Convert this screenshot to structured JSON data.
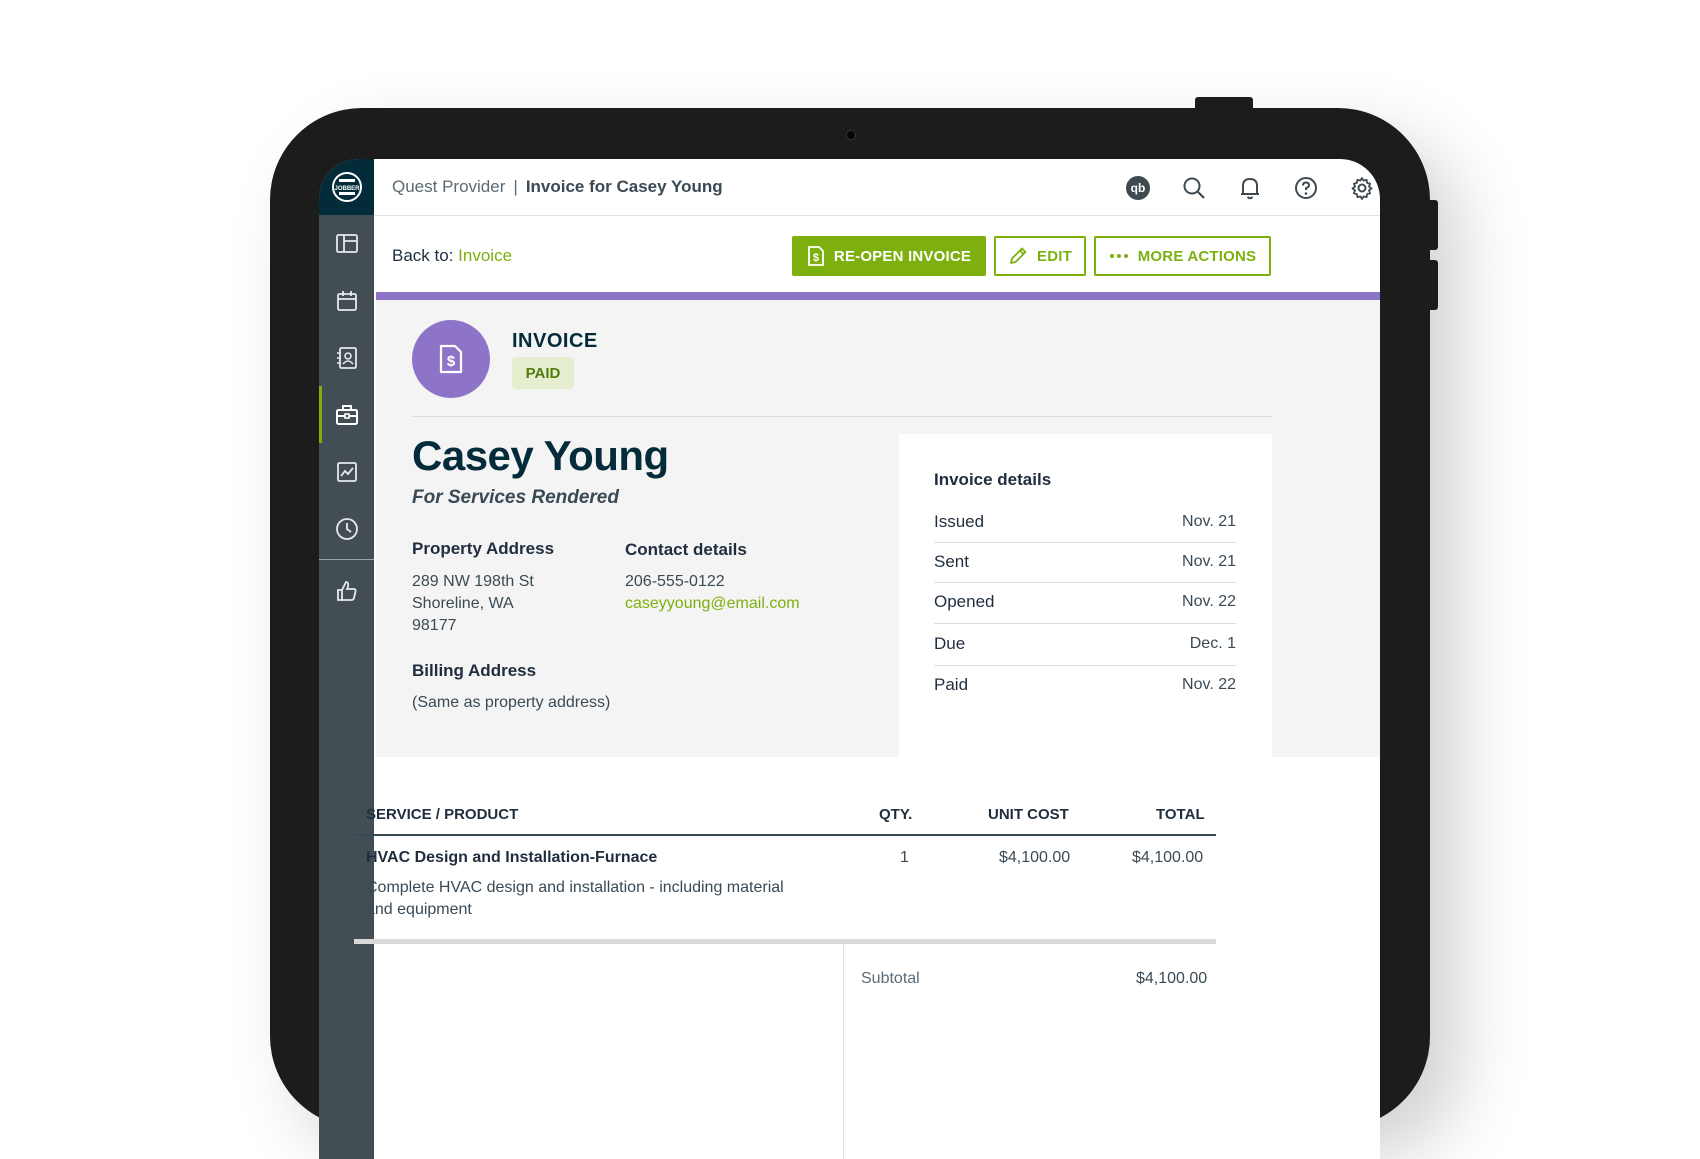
{
  "header": {
    "breadcrumb_root": "Quest Provider",
    "breadcrumb_separator": "|",
    "breadcrumb_current": "Invoice for Casey Young"
  },
  "brand": {
    "logo_text": "JOBBER",
    "accent": "#7db00e",
    "purple": "#8e74c9",
    "navy": "#032b3a"
  },
  "sidebar": {
    "items": [
      {
        "icon": "dashboard-icon"
      },
      {
        "icon": "calendar-icon"
      },
      {
        "icon": "clients-icon"
      },
      {
        "icon": "work-briefcase-icon",
        "active": true
      },
      {
        "icon": "reports-chart-icon"
      },
      {
        "icon": "timesheet-clock-icon"
      },
      {
        "icon": "thumbs-up-icon"
      }
    ]
  },
  "top_icons": [
    "quickbooks-icon",
    "search-icon",
    "bell-icon",
    "help-icon",
    "gear-icon"
  ],
  "quickbooks_label": "qb",
  "actions": {
    "back_prefix": "Back to:",
    "back_link": "Invoice",
    "reopen_label": "RE-OPEN INVOICE",
    "edit_label": "EDIT",
    "more_label": "MORE ACTIONS"
  },
  "invoice": {
    "label": "INVOICE",
    "status": "PAID",
    "client_name": "Casey Young",
    "subtitle": "For Services Rendered",
    "property_address_label": "Property Address",
    "property_address_lines": [
      "289 NW 198th St",
      "Shoreline, WA",
      "98177"
    ],
    "contact_label": "Contact details",
    "phone": "206-555-0122",
    "email": "caseyyoung@email.com",
    "billing_label": "Billing Address",
    "billing_value": "(Same as property address)"
  },
  "details": {
    "title": "Invoice details",
    "rows": [
      {
        "label": "Issued",
        "value": "Nov. 21"
      },
      {
        "label": "Sent",
        "value": "Nov. 21"
      },
      {
        "label": "Opened",
        "value": "Nov. 22"
      },
      {
        "label": "Due",
        "value": "Dec. 1"
      },
      {
        "label": "Paid",
        "value": "Nov. 22"
      }
    ]
  },
  "line_items": {
    "headers": [
      "SERVICE / PRODUCT",
      "QTY.",
      "UNIT COST",
      "TOTAL"
    ],
    "rows": [
      {
        "name": "HVAC Design and Installation-Furnace",
        "description_line1": "Complete HVAC design and installation - including material",
        "description_line2": "and equipment",
        "qty": "1",
        "unit_cost": "$4,100.00",
        "total": "$4,100.00"
      }
    ],
    "subtotal_label": "Subtotal",
    "subtotal_value": "$4,100.00"
  }
}
